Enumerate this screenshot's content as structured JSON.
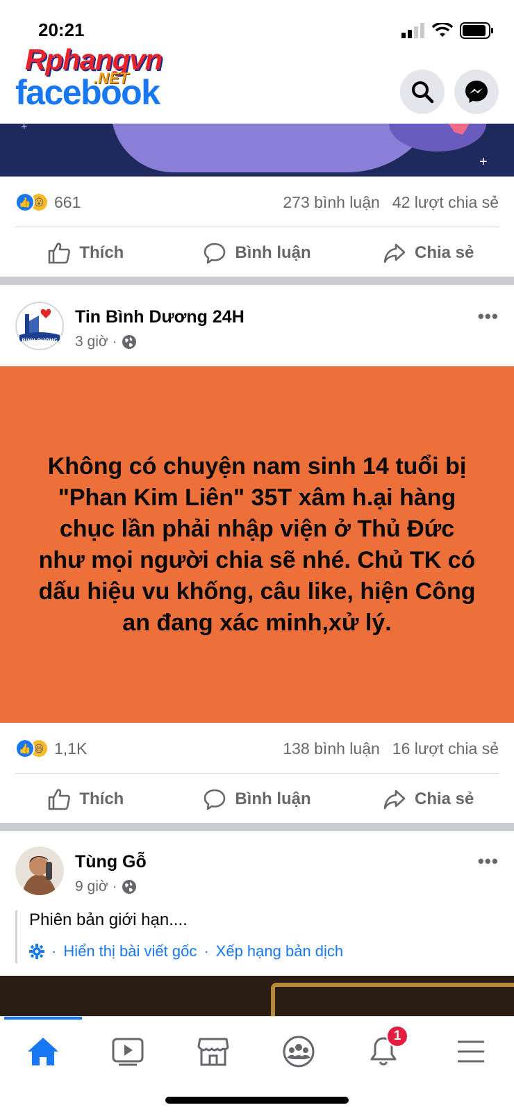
{
  "status": {
    "time": "20:21"
  },
  "watermark": {
    "main": "Rphangvn",
    "net": ".NET"
  },
  "header": {
    "logo": "facebook",
    "search_icon": "search-icon",
    "messenger_icon": "messenger-icon"
  },
  "post1": {
    "reaction_count": "661",
    "comments": "273 bình luận",
    "shares": "42 lượt chia sẻ"
  },
  "actions": {
    "like": "Thích",
    "comment": "Bình luận",
    "share": "Chia sẻ"
  },
  "post2": {
    "author": "Tin Bình Dương 24H",
    "avatar_text": "BÌNH DƯƠNG",
    "time": "3 giờ",
    "separator": "·",
    "card_text": "Không có chuyện nam sinh 14 tuổi bị \"Phan Kim Liên\" 35T xâm h.ại hàng chục lần phải nhập viện ở Thủ Đức như mọi người chia sẽ nhé. Chủ TK có dấu hiệu vu khống, câu like, hiện Công an đang xác minh,xử lý.",
    "card_color": "#ed6f39",
    "reaction_count": "1,1K",
    "comments": "138 bình luận",
    "shares": "16 lượt chia sẻ"
  },
  "post3": {
    "author": "Tùng Gỗ",
    "time": "9 giờ",
    "separator": "·",
    "text": "Phiên bản giới hạn....",
    "translate_sep1": "·",
    "see_original": "Hiển thị bài viết gốc",
    "translate_sep2": "·",
    "rate_translation": "Xếp hạng bản dịch"
  },
  "more_label": "•••",
  "tabbar": {
    "notification_badge": "1"
  },
  "colors": {
    "accent": "#1877f2",
    "badge": "#e41e3f"
  }
}
